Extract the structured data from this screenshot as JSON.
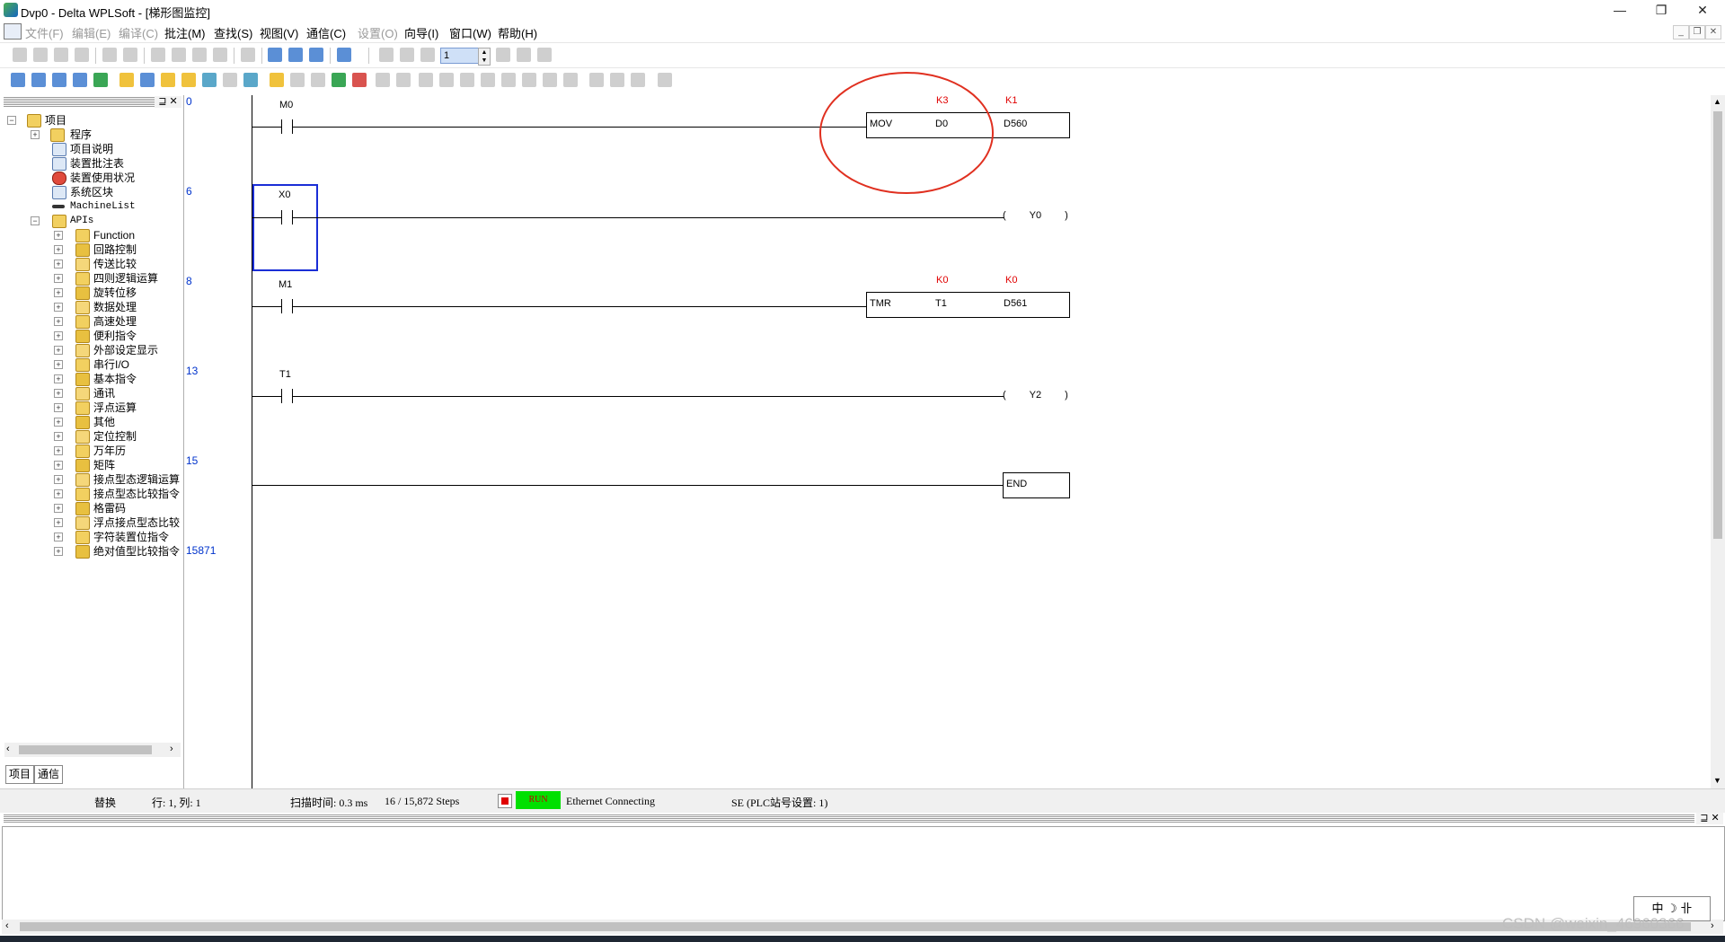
{
  "window": {
    "title": "Dvp0 - Delta WPLSoft - [梯形图监控]",
    "minimize_glyph": "—",
    "maximize_glyph": "❐",
    "close_glyph": "✕"
  },
  "menu": {
    "items": [
      "文件(F)",
      "编辑(E)",
      "编译(C)",
      "批注(M)",
      "查找(S)",
      "视图(V)",
      "通信(C)",
      "设置(O)",
      "向导(I)",
      "窗口(W)",
      "帮助(H)"
    ],
    "disabled": [
      true,
      true,
      true,
      false,
      false,
      false,
      false,
      true,
      false,
      false,
      false
    ]
  },
  "toolbar": {
    "step_value": "1"
  },
  "project_tree": {
    "root": "项目",
    "items": [
      "程序",
      "项目说明",
      "装置批注表",
      "装置使用状况",
      "系统区块",
      "MachineList",
      "APIs"
    ],
    "apis": [
      "Function",
      "回路控制",
      "传送比较",
      "四则逻辑运算",
      "旋转位移",
      "数据处理",
      "高速处理",
      "便利指令",
      "外部设定显示",
      "串行I/O",
      "基本指令",
      "通讯",
      "浮点运算",
      "其他",
      "定位控制",
      "万年历",
      "矩阵",
      "接点型态逻辑运算",
      "接点型态比较指令",
      "格雷码",
      "浮点接点型态比较",
      "字符装置位指令",
      "绝对值型比较指令"
    ]
  },
  "panel_tabs": [
    "项目",
    "通信"
  ],
  "ladder": {
    "step_numbers": [
      "0",
      "6",
      "8",
      "13",
      "15",
      "15871"
    ],
    "rung0": {
      "contact": "M0",
      "instr": "MOV",
      "op1": "D0",
      "op2": "D560",
      "op1_val": "K3",
      "op2_val": "K1"
    },
    "rung1": {
      "contact": "X0",
      "coil": "Y0"
    },
    "rung2": {
      "contact": "M1",
      "instr": "TMR",
      "op1": "T1",
      "op2": "D561",
      "op1_val": "K0",
      "op2_val": "K0"
    },
    "rung3": {
      "contact": "T1",
      "coil": "Y2"
    },
    "rung4": {
      "end": "END"
    }
  },
  "status": {
    "mode": "替换",
    "position": "行: 1, 列: 1",
    "scan_time": "扫描时间: 0.3 ms",
    "steps": "16 / 15,872 Steps",
    "run": "RUN",
    "connection": "Ethernet Connecting",
    "station": "SE (PLC站号设置: 1)"
  },
  "ime": "中 ☽ 卝",
  "watermark": "CSDN @weixin_46960366"
}
